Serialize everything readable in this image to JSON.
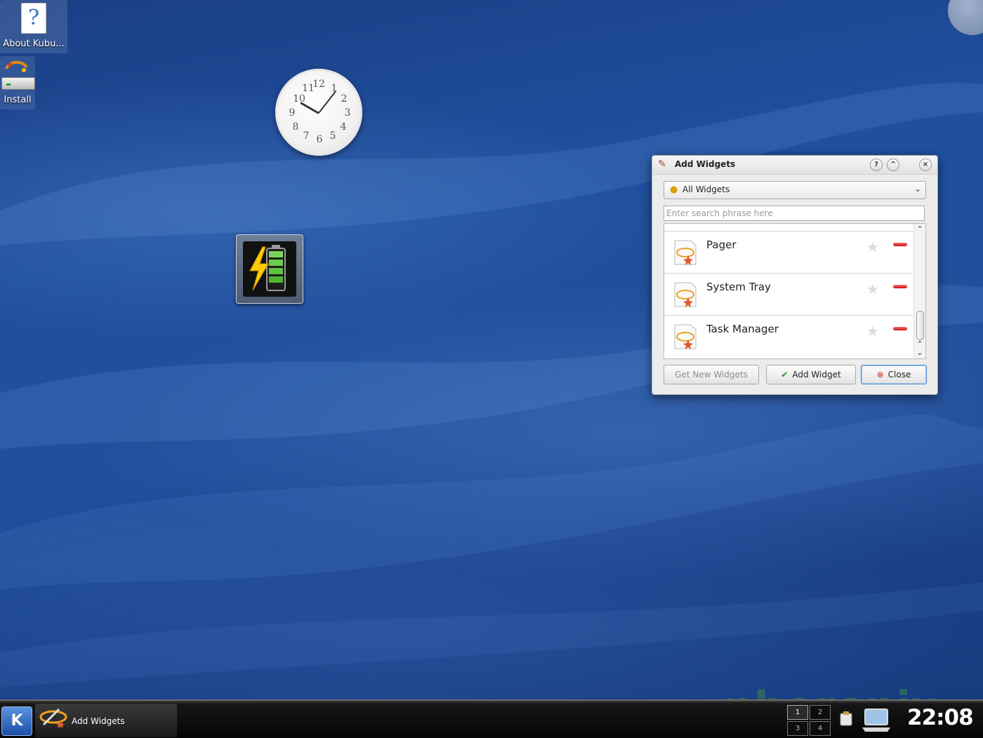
{
  "desktop": {
    "icons": [
      {
        "label": "About Kubu..."
      },
      {
        "label": "Install"
      }
    ]
  },
  "clock_widget": {
    "numbers": [
      "12",
      "1",
      "2",
      "3",
      "4",
      "5",
      "6",
      "7",
      "8",
      "9",
      "10",
      "11"
    ]
  },
  "dialog": {
    "title": "Add Widgets",
    "help_glyph": "?",
    "shade_glyph": "^",
    "close_glyph": "×",
    "category": "All Widgets",
    "search_placeholder": "Enter search phrase here",
    "items": [
      {
        "name": "Pager"
      },
      {
        "name": "System Tray"
      },
      {
        "name": "Task Manager"
      }
    ],
    "buttons": {
      "get_new": "Get New Widgets",
      "add": "Add Widget",
      "close": "Close"
    }
  },
  "taskbar": {
    "kmenu_label": "K",
    "task_label": "Add Widgets",
    "pager": [
      "1",
      "2",
      "3",
      "4"
    ],
    "time": "22:08"
  },
  "watermark": "phoronix",
  "colors": {
    "accent": "#4e8ad1",
    "remove_red": "#c71010",
    "wallpaper": "#1f4f9e"
  }
}
